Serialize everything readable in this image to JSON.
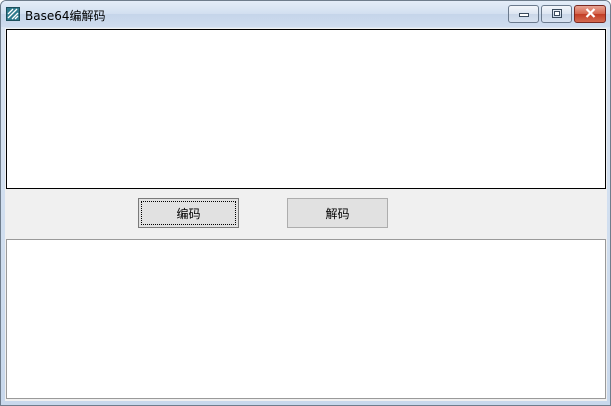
{
  "window": {
    "title": "Base64编解码",
    "icon": "app-icon"
  },
  "caption_buttons": {
    "minimize_icon": "minimize-icon",
    "maximize_icon": "maximize-icon",
    "close_icon": "close-icon"
  },
  "input": {
    "value": ""
  },
  "buttons": {
    "encode_label": "编码",
    "decode_label": "解码"
  },
  "output": {
    "value": ""
  },
  "colors": {
    "client_bg": "#f0f0f0",
    "close_button": "#c23c24",
    "title_bar": "#d2dff0"
  }
}
